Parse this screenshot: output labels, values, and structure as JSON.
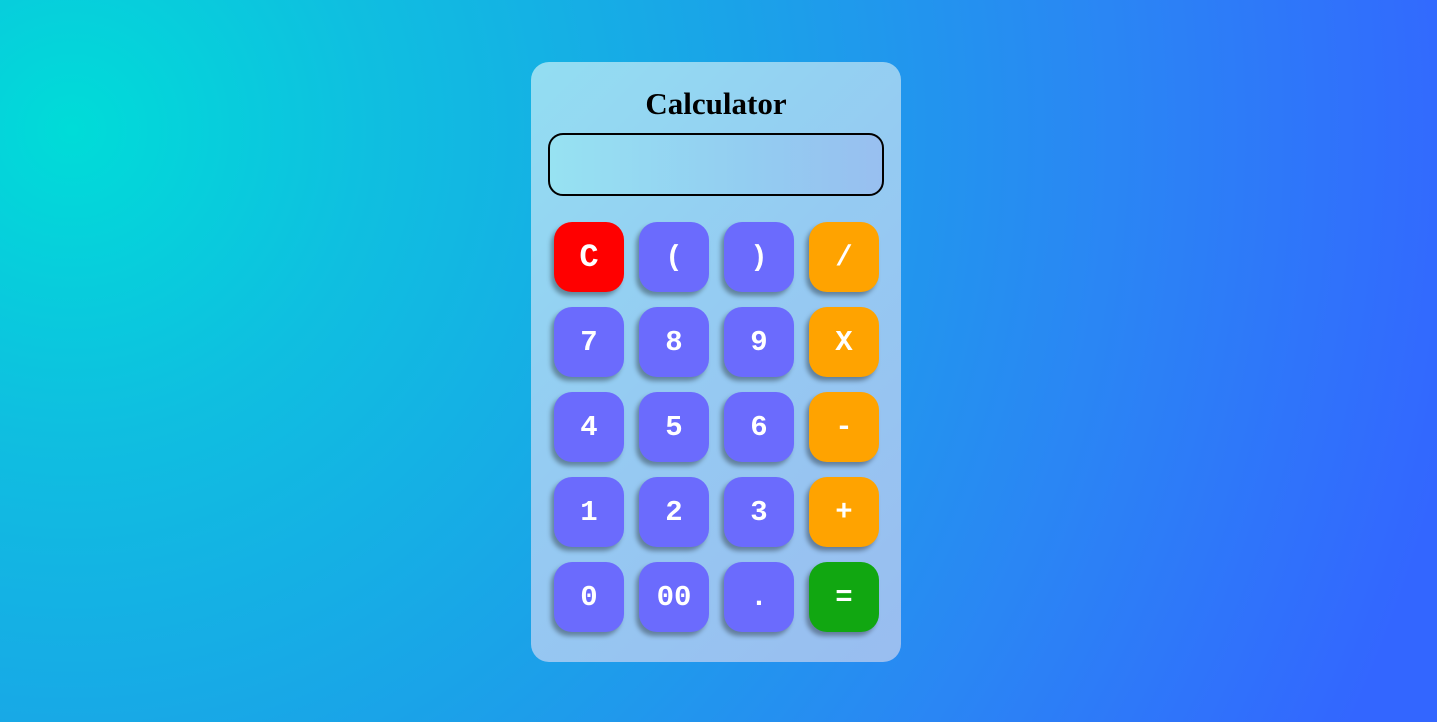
{
  "title": "Calculator",
  "display": {
    "value": ""
  },
  "buttons": {
    "clear": "C",
    "open_paren": "(",
    "close_paren": ")",
    "divide": "/",
    "seven": "7",
    "eight": "8",
    "nine": "9",
    "multiply": "X",
    "four": "4",
    "five": "5",
    "six": "6",
    "subtract": "-",
    "one": "1",
    "two": "2",
    "three": "3",
    "add": "+",
    "zero": "0",
    "double_zero": "00",
    "decimal": ".",
    "equals": "="
  },
  "colors": {
    "number_button": "#6b6bfd",
    "operator_button": "#ffa300",
    "clear_button": "#ff0000",
    "equals_button": "#11a711"
  }
}
